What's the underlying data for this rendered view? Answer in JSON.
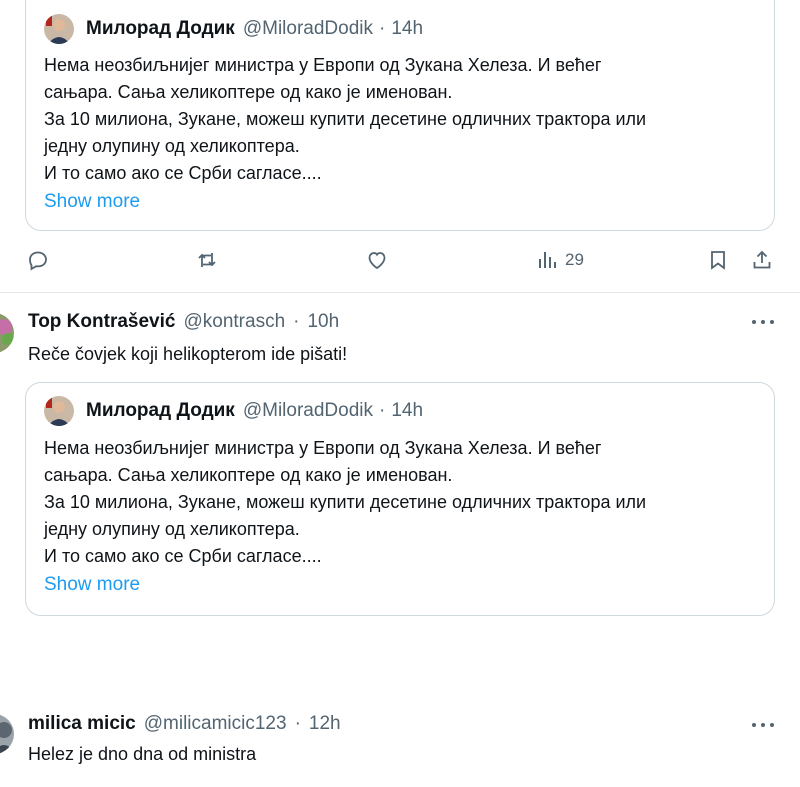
{
  "quote": {
    "author_name": "Милорад Додик",
    "author_handle": "@MiloradDodik",
    "separator": "·",
    "time": "14h",
    "lines": [
      "Нема неозбиљнијег министра у Европи од Зукана Хелеза. И већег",
      "сањара. Сања хеликоптере од како је именован.",
      "За 10 милиона, Зукане, можеш купити десетине одличних трактора или",
      "једну олупину од хеликоптера.",
      "И то само ако се Срби сагласе...."
    ],
    "show_more": "Show more"
  },
  "actions": {
    "views_count": "29"
  },
  "reply1": {
    "name": "Top Kontrašević",
    "handle": "@kontrasch",
    "separator": "·",
    "time": "10h",
    "text": "Reče čovjek koji helikopterom ide pišati!"
  },
  "reply2": {
    "name": "milica micic",
    "handle": "@milicamicic123",
    "separator": "·",
    "time": "12h",
    "text": "Helez je dno dna od ministra"
  },
  "icons": {
    "reply": "comment-icon",
    "retweet": "retweet-icon",
    "like": "heart-icon",
    "views": "views-icon",
    "bookmark": "bookmark-icon",
    "share": "share-icon",
    "more": "more-icon"
  },
  "colors": {
    "link": "#1d9bf0",
    "secondary_text": "#536471",
    "border": "#cfd9de"
  }
}
